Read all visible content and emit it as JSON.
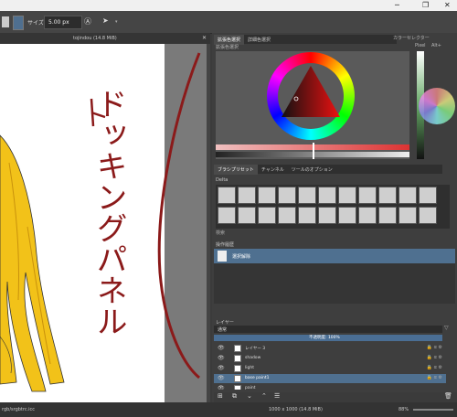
{
  "window": {
    "minimize": "─",
    "maximize": "❐",
    "close": "✕"
  },
  "tool_options": {
    "size_label": "サイズ:",
    "size_value": "5.00 px"
  },
  "document": {
    "tab_title": "tojindou (14.8 MiB)",
    "close": "✕"
  },
  "annotation": {
    "text": "ドッキングパネル",
    "color": "#8b1a1a"
  },
  "color_dockers": {
    "tabs": [
      "拡張色選択",
      "詳細色選択"
    ],
    "panel_title": "拡張色選択",
    "right_title": "カラーセレクター",
    "right_opts": [
      "Pixel",
      "Alt+"
    ]
  },
  "brush_dockers": {
    "tabs": [
      "ブラシプリセット",
      "チャンネル",
      "ツールのオプション"
    ],
    "tag_label": "Delta",
    "footer_label": "検索"
  },
  "history": {
    "title": "操作履歴",
    "items": [
      "選択解除"
    ]
  },
  "layers": {
    "title": "レイヤー",
    "blend_mode": "通常",
    "opacity": "不透明度: 100%",
    "items": [
      {
        "name": "レイヤー 3",
        "selected": false
      },
      {
        "name": "shadow",
        "selected": false
      },
      {
        "name": "light",
        "selected": false
      },
      {
        "name": "base paint1",
        "selected": true
      },
      {
        "name": "paint",
        "selected": false
      }
    ]
  },
  "status": {
    "left": "rgb/srgbtrc.icc",
    "center": "1000 x 1000 (14.8 MiB)",
    "zoom": "88%"
  },
  "colors": {
    "accent": "#4f6f8f",
    "selection": "#4f7090"
  }
}
